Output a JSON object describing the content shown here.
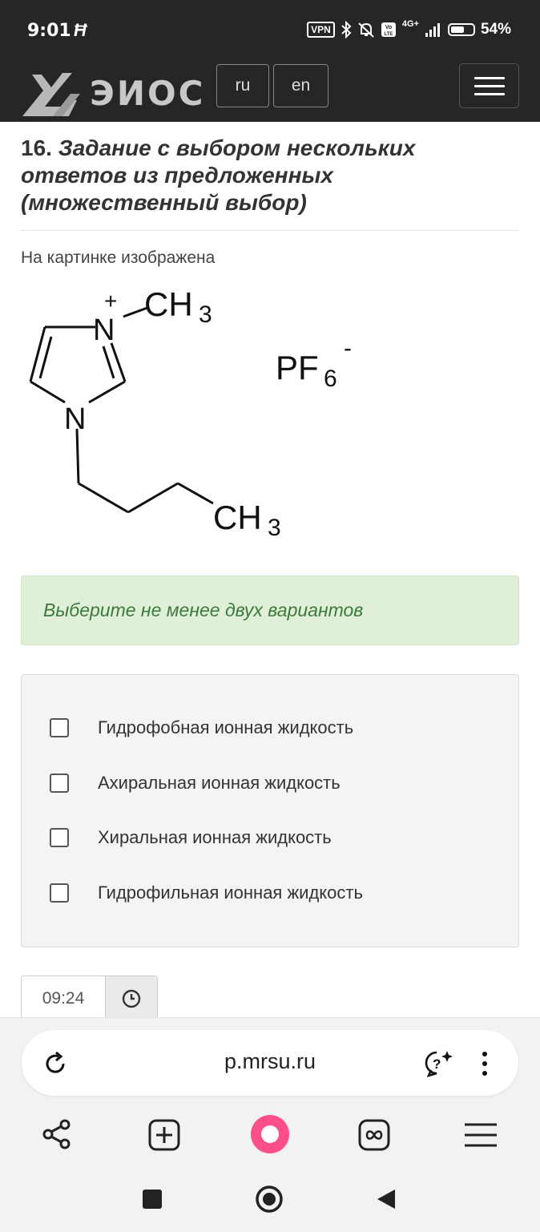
{
  "status_bar": {
    "time": "9:01",
    "network_badge": "VPN",
    "cell": "4G+",
    "battery": "54%",
    "battery_level": 0.54
  },
  "header": {
    "logo_text": "ЭИОС",
    "lang_ru": "ru",
    "lang_en": "en"
  },
  "question": {
    "number": "16.",
    "title": "Задание с выбором нескольких ответов из предложенных (множественный выбор)",
    "prompt": "На картинке изображена",
    "image": {
      "atom_n_plus": "N",
      "charge_plus": "+",
      "ch3_top": "CH",
      "ch3_top_sub": "3",
      "atom_n": "N",
      "ch3_bottom": "CH",
      "ch3_bottom_sub": "3",
      "anion": "PF",
      "anion_sub": "6",
      "anion_charge": "-"
    },
    "hint": "Выберите не менее двух вариантов",
    "options": [
      {
        "label": "Гидрофобная ионная жидкость",
        "checked": false
      },
      {
        "label": "Ахиральная ионная жидкость",
        "checked": false
      },
      {
        "label": "Хиральная ионная жидкость",
        "checked": false
      },
      {
        "label": "Гидрофильная ионная жидкость",
        "checked": false
      }
    ],
    "timer": "09:24"
  },
  "browser": {
    "url": "p.mrsu.ru"
  },
  "colors": {
    "header_bg": "#262626",
    "hint_bg": "#e0f0d8",
    "hint_text": "#3c7a3c",
    "alice_pink": "#ff4f8b"
  }
}
